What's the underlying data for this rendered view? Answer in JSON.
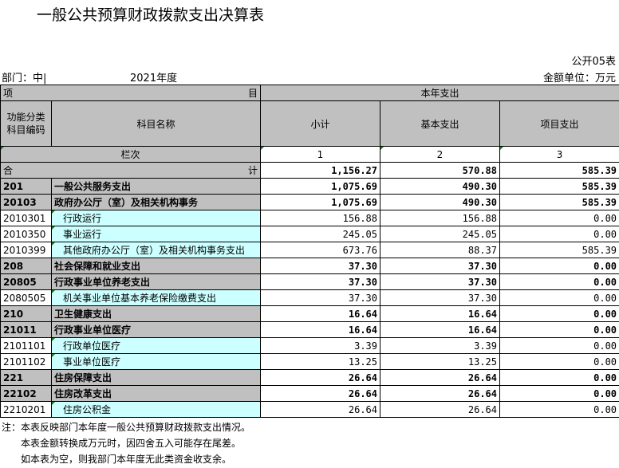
{
  "title": "一般公共预算财政拨款支出决算表",
  "table_code": "公开05表",
  "department": "部门：中|",
  "year": "2021年度",
  "unit": "金额单位：万元",
  "headers": {
    "xiang": "项",
    "mu": "目",
    "current_year": "本年支出",
    "code_col": "功能分类\n科目编码",
    "name_col": "科目名称",
    "subtotal": "小计",
    "basic": "基本支出",
    "project": "项目支出",
    "lanci": "栏次",
    "col1": "1",
    "col2": "2",
    "col3": "3"
  },
  "total": {
    "he": "合",
    "ji": "计",
    "subtotal": "1,156.27",
    "basic": "570.88",
    "project": "585.39"
  },
  "rows": [
    {
      "code": "201",
      "name": "一般公共服务支出",
      "subtotal": "1,075.69",
      "basic": "490.30",
      "project": "585.39",
      "level": "top"
    },
    {
      "code": "20103",
      "name": "政府办公厅（室）及相关机构事务",
      "subtotal": "1,075.69",
      "basic": "490.30",
      "project": "585.39",
      "level": "top"
    },
    {
      "code": "2010301",
      "name": "行政运行",
      "subtotal": "156.88",
      "basic": "156.88",
      "project": "0.00",
      "level": "sub"
    },
    {
      "code": "2010350",
      "name": "事业运行",
      "subtotal": "245.05",
      "basic": "245.05",
      "project": "0.00",
      "level": "sub"
    },
    {
      "code": "2010399",
      "name": "其他政府办公厅（室）及相关机构事务支出",
      "subtotal": "673.76",
      "basic": "88.37",
      "project": "585.39",
      "level": "sub"
    },
    {
      "code": "208",
      "name": "社会保障和就业支出",
      "subtotal": "37.30",
      "basic": "37.30",
      "project": "0.00",
      "level": "top"
    },
    {
      "code": "20805",
      "name": "行政事业单位养老支出",
      "subtotal": "37.30",
      "basic": "37.30",
      "project": "0.00",
      "level": "top"
    },
    {
      "code": "2080505",
      "name": "机关事业单位基本养老保险缴费支出",
      "subtotal": "37.30",
      "basic": "37.30",
      "project": "0.00",
      "level": "sub"
    },
    {
      "code": "210",
      "name": "卫生健康支出",
      "subtotal": "16.64",
      "basic": "16.64",
      "project": "0.00",
      "level": "top"
    },
    {
      "code": "21011",
      "name": "行政事业单位医疗",
      "subtotal": "16.64",
      "basic": "16.64",
      "project": "0.00",
      "level": "top"
    },
    {
      "code": "2101101",
      "name": "行政单位医疗",
      "subtotal": "3.39",
      "basic": "3.39",
      "project": "0.00",
      "level": "sub"
    },
    {
      "code": "2101102",
      "name": "事业单位医疗",
      "subtotal": "13.25",
      "basic": "13.25",
      "project": "0.00",
      "level": "sub"
    },
    {
      "code": "221",
      "name": "住房保障支出",
      "subtotal": "26.64",
      "basic": "26.64",
      "project": "0.00",
      "level": "top"
    },
    {
      "code": "22102",
      "name": "住房改革支出",
      "subtotal": "26.64",
      "basic": "26.64",
      "project": "0.00",
      "level": "top"
    },
    {
      "code": "2210201",
      "name": "住房公积金",
      "subtotal": "26.64",
      "basic": "26.64",
      "project": "0.00",
      "level": "sub"
    }
  ],
  "notes": [
    "注：本表反映部门本年度一般公共预算财政拨款支出情况。",
    "　　本表金额转换成万元时，因四舍五入可能存在尾差。",
    "　　如本表为空，则我部门本年度无此类资金收支余。"
  ]
}
